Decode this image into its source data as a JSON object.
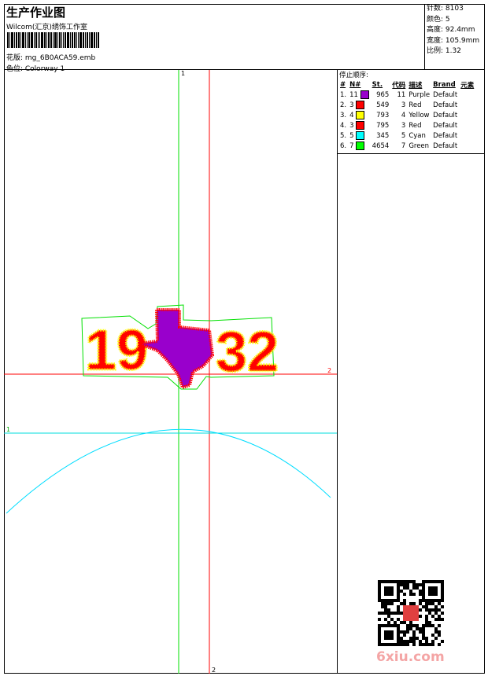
{
  "header": {
    "title": "生产作业图",
    "subtitle": "Wilcom(汇京)绣饰工作室",
    "design_label": "花版: mg_6B0ACA59.emb",
    "colorway_label": "色位:  Colorway 1"
  },
  "info": {
    "stitches": "针数: 8103",
    "colors": "颜色: 5",
    "height": "高度: 92.4mm",
    "width": "宽度: 105.9mm",
    "scale": "比例: 1.32"
  },
  "stop_sequence": {
    "caption": "停止顺序:",
    "headers": [
      "#",
      "N#",
      "St.",
      "代码",
      "描述",
      "Brand",
      "元素"
    ],
    "rows": [
      {
        "idx": "1.",
        "n": "11",
        "color": "#9900cc",
        "st": "965",
        "code": "11",
        "desc": "Purple",
        "brand": "Default"
      },
      {
        "idx": "2.",
        "n": "3",
        "color": "#ff0000",
        "st": "549",
        "code": "3",
        "desc": "Red",
        "brand": "Default"
      },
      {
        "idx": "3.",
        "n": "4",
        "color": "#ffff00",
        "st": "793",
        "code": "4",
        "desc": "Yellow",
        "brand": "Default"
      },
      {
        "idx": "4.",
        "n": "3",
        "color": "#ff0000",
        "st": "795",
        "code": "3",
        "desc": "Red",
        "brand": "Default"
      },
      {
        "idx": "5.",
        "n": "5",
        "color": "#00ffff",
        "st": "345",
        "code": "5",
        "desc": "Cyan",
        "brand": "Default"
      },
      {
        "idx": "6.",
        "n": "7",
        "color": "#00ff00",
        "st": "4654",
        "code": "7",
        "desc": "Green",
        "brand": "Default"
      }
    ]
  },
  "canvas": {
    "guide_green_label": "1",
    "guide_red_label": "2",
    "h_red_label": "2",
    "h_cyan_label": "1",
    "design_text_left": "19",
    "design_text_right": "32"
  },
  "watermark": "6xiu.com"
}
